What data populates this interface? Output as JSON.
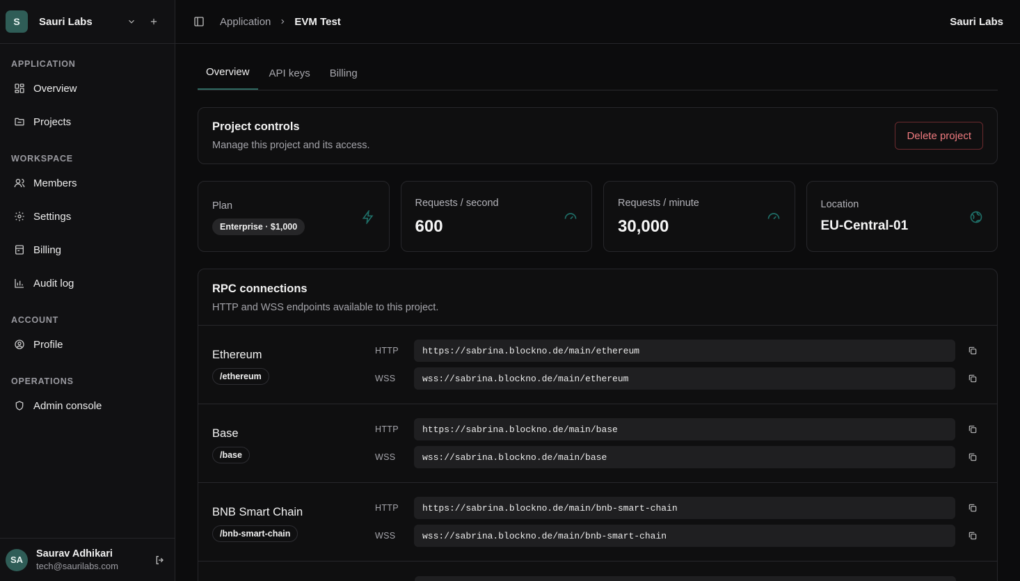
{
  "workspace": {
    "initial": "S",
    "name": "Sauri Labs"
  },
  "sidebar": {
    "sections": [
      {
        "heading": "APPLICATION",
        "items": [
          {
            "label": "Overview",
            "icon": "grid-icon"
          },
          {
            "label": "Projects",
            "icon": "folder-icon"
          }
        ]
      },
      {
        "heading": "WORKSPACE",
        "items": [
          {
            "label": "Members",
            "icon": "users-icon"
          },
          {
            "label": "Settings",
            "icon": "gear-icon"
          },
          {
            "label": "Billing",
            "icon": "billing-icon"
          },
          {
            "label": "Audit log",
            "icon": "chart-icon"
          }
        ]
      },
      {
        "heading": "ACCOUNT",
        "items": [
          {
            "label": "Profile",
            "icon": "user-circle-icon"
          }
        ]
      },
      {
        "heading": "OPERATIONS",
        "items": [
          {
            "label": "Admin console",
            "icon": "shield-icon"
          }
        ]
      }
    ]
  },
  "user": {
    "initials": "SA",
    "name": "Saurav Adhikari",
    "email": "tech@saurilabs.com"
  },
  "breadcrumb": {
    "parent": "Application",
    "current": "EVM Test"
  },
  "topbar": {
    "org": "Sauri Labs"
  },
  "tabs": [
    "Overview",
    "API keys",
    "Billing"
  ],
  "controls": {
    "title": "Project controls",
    "subtitle": "Manage this project and its access.",
    "delete_label": "Delete project"
  },
  "stats": {
    "plan_label": "Plan",
    "plan_badge": "Enterprise · $1,000",
    "rps_label": "Requests / second",
    "rps_value": "600",
    "rpm_label": "Requests / minute",
    "rpm_value": "30,000",
    "location_label": "Location",
    "location_value": "EU-Central-01"
  },
  "rpc": {
    "title": "RPC connections",
    "subtitle": "HTTP and WSS endpoints available to this project.",
    "http_label": "HTTP",
    "wss_label": "WSS",
    "chains": [
      {
        "name": "Ethereum",
        "path": "/ethereum",
        "http": "https://sabrina.blockno.de/main/ethereum",
        "wss": "wss://sabrina.blockno.de/main/ethereum"
      },
      {
        "name": "Base",
        "path": "/base",
        "http": "https://sabrina.blockno.de/main/base",
        "wss": "wss://sabrina.blockno.de/main/base"
      },
      {
        "name": "BNB Smart Chain",
        "path": "/bnb-smart-chain",
        "http": "https://sabrina.blockno.de/main/bnb-smart-chain",
        "wss": "wss://sabrina.blockno.de/main/bnb-smart-chain"
      }
    ]
  },
  "colors": {
    "accent": "#2f6a61",
    "danger": "#f07b7f",
    "background": "#0c0c0d"
  }
}
